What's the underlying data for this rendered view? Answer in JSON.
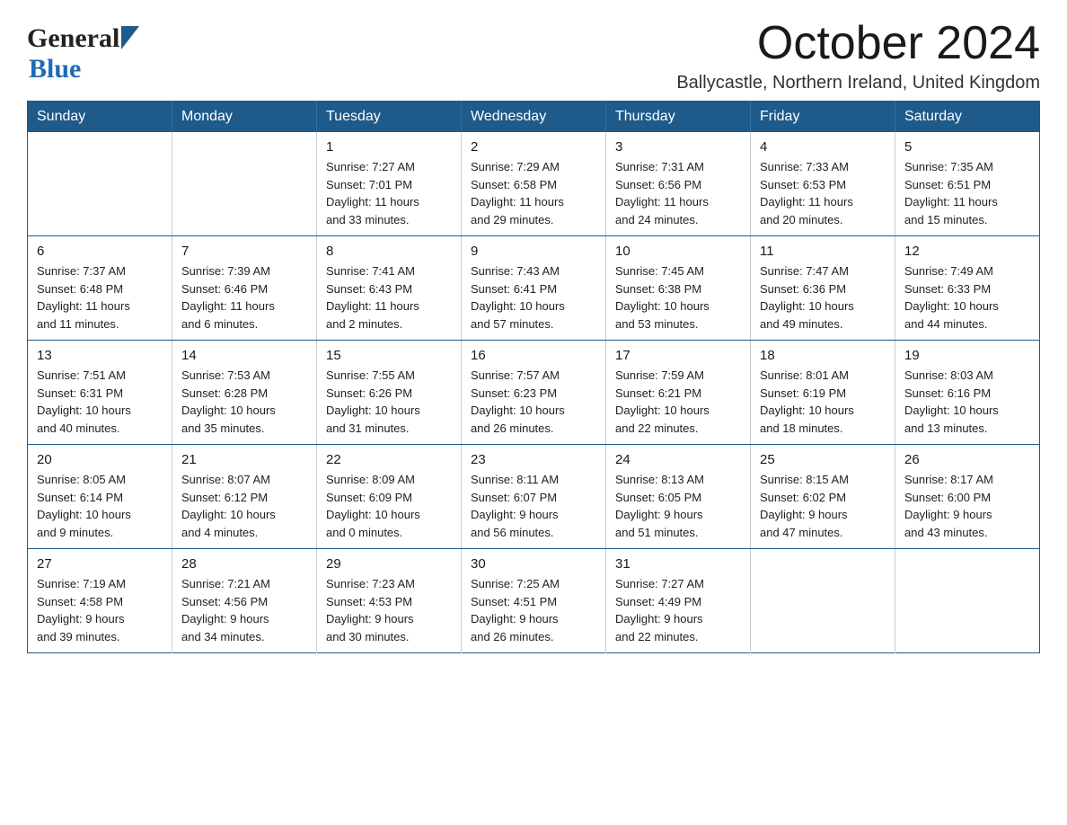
{
  "header": {
    "logo_general": "General",
    "logo_blue": "Blue",
    "month_title": "October 2024",
    "location": "Ballycastle, Northern Ireland, United Kingdom"
  },
  "weekdays": [
    "Sunday",
    "Monday",
    "Tuesday",
    "Wednesday",
    "Thursday",
    "Friday",
    "Saturday"
  ],
  "weeks": [
    [
      {
        "day": "",
        "info": ""
      },
      {
        "day": "",
        "info": ""
      },
      {
        "day": "1",
        "info": "Sunrise: 7:27 AM\nSunset: 7:01 PM\nDaylight: 11 hours\nand 33 minutes."
      },
      {
        "day": "2",
        "info": "Sunrise: 7:29 AM\nSunset: 6:58 PM\nDaylight: 11 hours\nand 29 minutes."
      },
      {
        "day": "3",
        "info": "Sunrise: 7:31 AM\nSunset: 6:56 PM\nDaylight: 11 hours\nand 24 minutes."
      },
      {
        "day": "4",
        "info": "Sunrise: 7:33 AM\nSunset: 6:53 PM\nDaylight: 11 hours\nand 20 minutes."
      },
      {
        "day": "5",
        "info": "Sunrise: 7:35 AM\nSunset: 6:51 PM\nDaylight: 11 hours\nand 15 minutes."
      }
    ],
    [
      {
        "day": "6",
        "info": "Sunrise: 7:37 AM\nSunset: 6:48 PM\nDaylight: 11 hours\nand 11 minutes."
      },
      {
        "day": "7",
        "info": "Sunrise: 7:39 AM\nSunset: 6:46 PM\nDaylight: 11 hours\nand 6 minutes."
      },
      {
        "day": "8",
        "info": "Sunrise: 7:41 AM\nSunset: 6:43 PM\nDaylight: 11 hours\nand 2 minutes."
      },
      {
        "day": "9",
        "info": "Sunrise: 7:43 AM\nSunset: 6:41 PM\nDaylight: 10 hours\nand 57 minutes."
      },
      {
        "day": "10",
        "info": "Sunrise: 7:45 AM\nSunset: 6:38 PM\nDaylight: 10 hours\nand 53 minutes."
      },
      {
        "day": "11",
        "info": "Sunrise: 7:47 AM\nSunset: 6:36 PM\nDaylight: 10 hours\nand 49 minutes."
      },
      {
        "day": "12",
        "info": "Sunrise: 7:49 AM\nSunset: 6:33 PM\nDaylight: 10 hours\nand 44 minutes."
      }
    ],
    [
      {
        "day": "13",
        "info": "Sunrise: 7:51 AM\nSunset: 6:31 PM\nDaylight: 10 hours\nand 40 minutes."
      },
      {
        "day": "14",
        "info": "Sunrise: 7:53 AM\nSunset: 6:28 PM\nDaylight: 10 hours\nand 35 minutes."
      },
      {
        "day": "15",
        "info": "Sunrise: 7:55 AM\nSunset: 6:26 PM\nDaylight: 10 hours\nand 31 minutes."
      },
      {
        "day": "16",
        "info": "Sunrise: 7:57 AM\nSunset: 6:23 PM\nDaylight: 10 hours\nand 26 minutes."
      },
      {
        "day": "17",
        "info": "Sunrise: 7:59 AM\nSunset: 6:21 PM\nDaylight: 10 hours\nand 22 minutes."
      },
      {
        "day": "18",
        "info": "Sunrise: 8:01 AM\nSunset: 6:19 PM\nDaylight: 10 hours\nand 18 minutes."
      },
      {
        "day": "19",
        "info": "Sunrise: 8:03 AM\nSunset: 6:16 PM\nDaylight: 10 hours\nand 13 minutes."
      }
    ],
    [
      {
        "day": "20",
        "info": "Sunrise: 8:05 AM\nSunset: 6:14 PM\nDaylight: 10 hours\nand 9 minutes."
      },
      {
        "day": "21",
        "info": "Sunrise: 8:07 AM\nSunset: 6:12 PM\nDaylight: 10 hours\nand 4 minutes."
      },
      {
        "day": "22",
        "info": "Sunrise: 8:09 AM\nSunset: 6:09 PM\nDaylight: 10 hours\nand 0 minutes."
      },
      {
        "day": "23",
        "info": "Sunrise: 8:11 AM\nSunset: 6:07 PM\nDaylight: 9 hours\nand 56 minutes."
      },
      {
        "day": "24",
        "info": "Sunrise: 8:13 AM\nSunset: 6:05 PM\nDaylight: 9 hours\nand 51 minutes."
      },
      {
        "day": "25",
        "info": "Sunrise: 8:15 AM\nSunset: 6:02 PM\nDaylight: 9 hours\nand 47 minutes."
      },
      {
        "day": "26",
        "info": "Sunrise: 8:17 AM\nSunset: 6:00 PM\nDaylight: 9 hours\nand 43 minutes."
      }
    ],
    [
      {
        "day": "27",
        "info": "Sunrise: 7:19 AM\nSunset: 4:58 PM\nDaylight: 9 hours\nand 39 minutes."
      },
      {
        "day": "28",
        "info": "Sunrise: 7:21 AM\nSunset: 4:56 PM\nDaylight: 9 hours\nand 34 minutes."
      },
      {
        "day": "29",
        "info": "Sunrise: 7:23 AM\nSunset: 4:53 PM\nDaylight: 9 hours\nand 30 minutes."
      },
      {
        "day": "30",
        "info": "Sunrise: 7:25 AM\nSunset: 4:51 PM\nDaylight: 9 hours\nand 26 minutes."
      },
      {
        "day": "31",
        "info": "Sunrise: 7:27 AM\nSunset: 4:49 PM\nDaylight: 9 hours\nand 22 minutes."
      },
      {
        "day": "",
        "info": ""
      },
      {
        "day": "",
        "info": ""
      }
    ]
  ]
}
